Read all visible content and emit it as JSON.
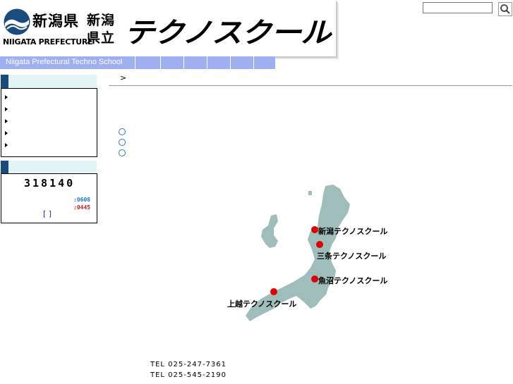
{
  "header": {
    "prefecture_jp": "新潟県",
    "prefecture_en": "NIIGATA PREFECTURE",
    "school_jp_line1": "新潟",
    "school_jp_line2": "県立",
    "school_logo": "テクノスクール"
  },
  "search": {
    "value": "",
    "placeholder": ""
  },
  "nav": {
    "title": "Niigata Prefectural Techno School",
    "tabs": [
      "",
      "",
      "",
      "",
      "",
      ""
    ]
  },
  "sidebar": {
    "menu_items": [
      "",
      "",
      "",
      "",
      ""
    ],
    "counter": {
      "total": "318140",
      "today": ":0608",
      "yesterday": ":0445",
      "link": "[ ]"
    }
  },
  "main": {
    "breadcrumb_arrow": ">",
    "bullets": [
      "",
      "",
      ""
    ]
  },
  "map": {
    "schools": [
      "新潟テクノスクール",
      "三条テクノスクール",
      "魚沼テクノスクール",
      "上越テクノスクール"
    ]
  },
  "contact": {
    "tel1": "TEL 025-247-7361",
    "tel2": "TEL 025-545-2190"
  },
  "colors": {
    "nav": "#9fb0f2",
    "sidebar_header": "#e3f4f4",
    "sidebar_mark": "#1a4b7e",
    "map_land": "#9fbdba",
    "school_dot": "#e00000"
  }
}
